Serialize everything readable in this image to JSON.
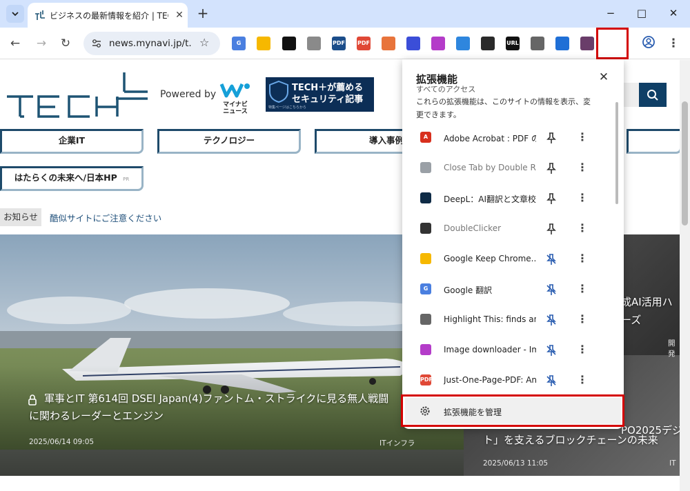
{
  "browser": {
    "tab": {
      "title": "ビジネスの最新情報を紹介 | TECH+"
    },
    "new_tab": "+",
    "window_controls": {
      "minimize": "−",
      "maximize": "□",
      "close": "✕"
    },
    "url": "news.mynavi.jp/t..."
  },
  "toolbar_extensions": [
    {
      "name": "google-translate-icon",
      "color": "#4a7fe0",
      "label": "G"
    },
    {
      "name": "google-keep-icon",
      "color": "#f6b800",
      "label": ""
    },
    {
      "name": "square-icon",
      "color": "#111111",
      "label": ""
    },
    {
      "name": "camera-icon",
      "color": "#8a8a8a",
      "label": ""
    },
    {
      "name": "pdf-icon",
      "color": "#1b4d8a",
      "label": "PDF"
    },
    {
      "name": "pdf-red-icon",
      "color": "#e04836",
      "label": "PDF"
    },
    {
      "name": "megaphone-icon",
      "color": "#e8743b",
      "label": ""
    },
    {
      "name": "wave-icon",
      "color": "#3b4ed8",
      "label": ""
    },
    {
      "name": "image-download-icon",
      "color": "#b43cc9",
      "label": ""
    },
    {
      "name": "phone-icon",
      "color": "#2e86de",
      "label": ""
    },
    {
      "name": "smile-icon",
      "color": "#2a2a2a",
      "label": ""
    },
    {
      "name": "url-icon",
      "color": "#111111",
      "label": "URL"
    },
    {
      "name": "highlighter-icon",
      "color": "#666666",
      "label": ""
    },
    {
      "name": "marker-icon",
      "color": "#1f6fd6",
      "label": ""
    },
    {
      "name": "avatar-ext-icon",
      "color": "#6a3d6a",
      "label": ""
    }
  ],
  "site": {
    "logo": "TECH+",
    "powered_by": "Powered by",
    "mynavi_label": "マイナビ ニュース",
    "banner": {
      "line1": "TECH＋が薦める",
      "line2": "セキュリティ記事",
      "line3": "特集ページはこちらから"
    },
    "menu": [
      "企業IT",
      "テクノロジー",
      "導入事例",
      "はたらくの未来へ/日本HP"
    ],
    "menu_pr": "PR",
    "notice_tag": "お知らせ",
    "notice_text": "酷似サイトにご注意ください",
    "hero_main": {
      "title_line1": "軍事とIT 第614回 DSEI Japan(4)ファントム・ストライクに見る無人戦闘",
      "title_line2": "に関わるレーダーとエンジン",
      "date": "2025/06/14 09:05",
      "category": "ITインフラ"
    },
    "hero_side": {
      "title_line1": "成AI活用ハ",
      "title_line2": "ーズ",
      "tag": "開発",
      "title_line3": "PO2025デジ",
      "title_line4": "ト」を支えるブロックチェーンの未来",
      "date": "2025/06/13 11:05",
      "category": "IT"
    }
  },
  "extensions_popup": {
    "title": "拡張機能",
    "section": "すべてのアクセス",
    "description": "これらの拡張機能は、このサイトの情報を表示、変更できます。",
    "items": [
      {
        "name": "Adobe Acrobat : PDF の...",
        "pinned": true,
        "color": "#d8301e",
        "icon_label": "A",
        "dim": false
      },
      {
        "name": "Close Tab by Double Ri...",
        "pinned": true,
        "color": "#9aa0a6",
        "icon_label": "",
        "dim": true
      },
      {
        "name": "DeepL：AI翻訳と文章校...",
        "pinned": true,
        "color": "#0f2b46",
        "icon_label": "",
        "dim": false
      },
      {
        "name": "DoubleClicker",
        "pinned": true,
        "color": "#333333",
        "icon_label": "",
        "dim": true
      },
      {
        "name": "Google Keep Chrome...",
        "pinned": false,
        "color": "#f6b800",
        "icon_label": "",
        "dim": false
      },
      {
        "name": "Google 翻訳",
        "pinned": false,
        "color": "#4a7fe0",
        "icon_label": "G",
        "dim": false
      },
      {
        "name": "Highlight This: finds an...",
        "pinned": false,
        "color": "#666666",
        "icon_label": "",
        "dim": false
      },
      {
        "name": "Image downloader - Im...",
        "pinned": false,
        "color": "#b43cc9",
        "icon_label": "",
        "dim": false
      },
      {
        "name": "Just-One-Page-PDF: An...",
        "pinned": false,
        "color": "#e04836",
        "icon_label": "PDF",
        "dim": false
      }
    ],
    "manage_label": "拡張機能を管理"
  }
}
